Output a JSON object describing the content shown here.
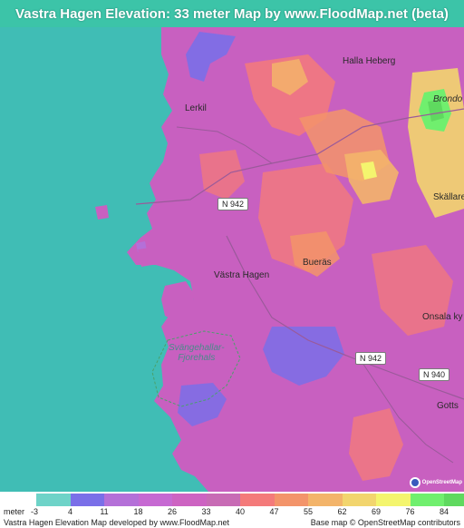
{
  "title": "Vastra Hagen Elevation: 33 meter Map by www.FloodMap.net (beta)",
  "colors": {
    "header": "#3cc4a8",
    "water": "#40bdb5",
    "base_land": "#c860c0"
  },
  "map_labels": {
    "halla_heberg": "Halla Heberg",
    "lerkil": "Lerkil",
    "brondo": "Brondo",
    "skallare": "Skällare",
    "vastra_hagen": "Västra Hagen",
    "bueras": "Bueräs",
    "svangehallar": "Svängehallar-",
    "fjorehals": "Fjorehals",
    "onsala": "Onsala ky",
    "gotts": "Gotts"
  },
  "road_shields": {
    "n942_a": "N 942",
    "n942_b": "N 942",
    "n940": "N 940"
  },
  "legend": {
    "unit_label": "meter",
    "colors": [
      "#6ed3c8",
      "#7a6fe8",
      "#b470d8",
      "#c669d2",
      "#cd63c2",
      "#c86bb5",
      "#f47a7a",
      "#f3946a",
      "#f3b46a",
      "#f2d56e",
      "#f4f56e",
      "#70ef6e",
      "#5fd95f"
    ],
    "ticks": [
      "-3",
      "4",
      "11",
      "18",
      "26",
      "33",
      "40",
      "47",
      "55",
      "62",
      "69",
      "76",
      "84"
    ]
  },
  "footer": {
    "left": "Vastra Hagen Elevation Map developed by www.FloodMap.net",
    "right": "Base map © OpenStreetMap contributors"
  },
  "osm_logo_text": "OpenStreetMap"
}
